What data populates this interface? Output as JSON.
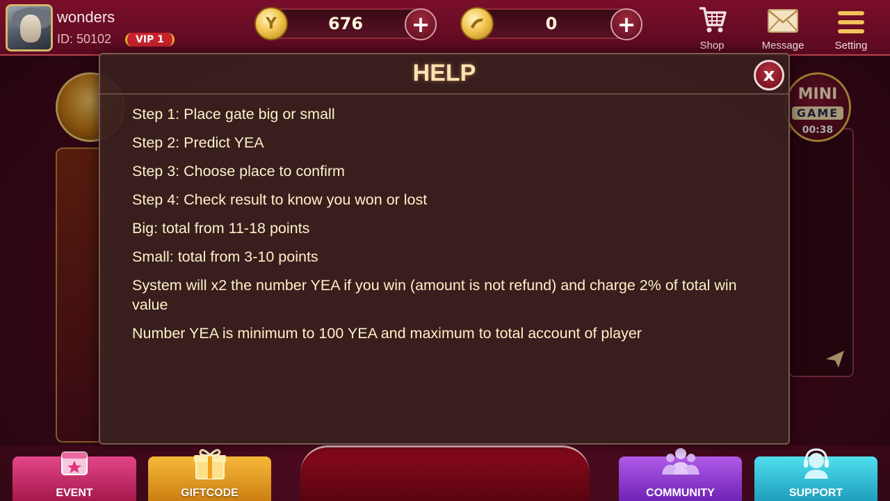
{
  "user": {
    "name": "wonders",
    "id_label": "ID: 50102",
    "vip": "VIP 1"
  },
  "currency": [
    {
      "icon": "yea-coin-icon",
      "symbol": "Y",
      "amount": "676",
      "add_label": "+"
    },
    {
      "icon": "gold-coin-icon",
      "symbol": "",
      "amount": "0",
      "add_label": "+"
    }
  ],
  "topnav": {
    "shop": "Shop",
    "message": "Message",
    "setting": "Setting"
  },
  "mini_game": {
    "line1": "MINI",
    "line2": "GAME",
    "timer": "00:38"
  },
  "help": {
    "title": "HELP",
    "close_label": "x",
    "lines": [
      "Step 1: Place gate big or small",
      "Step 2: Predict YEA",
      "Step 3: Choose place to confirm",
      "Step 4: Check result to know you won or lost",
      "Big: total from 11-18 points",
      "Small: total from 3-10 points",
      "System will x2 the number YEA if you win (amount is not refund) and charge 2% of total win value",
      "Number YEA is minimum to 100 YEA and maximum to total account of player"
    ]
  },
  "bottom": {
    "event": "EVENT",
    "giftcode": "GIFTCODE",
    "community": "COMMUNITY",
    "support": "SUPPORT"
  }
}
